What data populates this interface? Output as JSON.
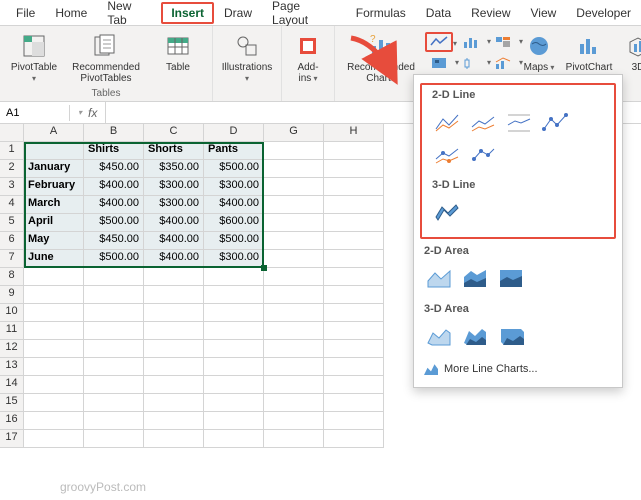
{
  "tabs": {
    "file": "File",
    "home": "Home",
    "newtab": "New Tab",
    "insert": "Insert",
    "draw": "Draw",
    "pagelayout": "Page Layout",
    "formulas": "Formulas",
    "data": "Data",
    "review": "Review",
    "view": "View",
    "developer": "Developer"
  },
  "ribbon": {
    "pivottable": "PivotTable",
    "recpivot": "Recommended\nPivotTables",
    "table": "Table",
    "tables_group": "Tables",
    "illustrations": "Illustrations",
    "addins": "Add-\nins",
    "reccharts": "Recommended\nCharts",
    "maps": "Maps",
    "pivotchart": "PivotChart",
    "threeD": "3D"
  },
  "fx": {
    "namebox": "A1",
    "symbol": "fx"
  },
  "cols": [
    "A",
    "B",
    "C",
    "D",
    "G",
    "H"
  ],
  "rows": [
    "1",
    "2",
    "3",
    "4",
    "5",
    "6",
    "7",
    "8",
    "9",
    "10",
    "11",
    "12",
    "13",
    "14",
    "15",
    "16",
    "17"
  ],
  "grid": {
    "hdr": [
      "",
      "Shirts",
      "Shorts",
      "Pants"
    ],
    "data": [
      [
        "January",
        "$450.00",
        "$350.00",
        "$500.00"
      ],
      [
        "February",
        "$400.00",
        "$300.00",
        "$300.00"
      ],
      [
        "March",
        "$400.00",
        "$300.00",
        "$400.00"
      ],
      [
        "April",
        "$500.00",
        "$400.00",
        "$600.00"
      ],
      [
        "May",
        "$450.00",
        "$400.00",
        "$500.00"
      ],
      [
        "June",
        "$500.00",
        "$400.00",
        "$300.00"
      ]
    ]
  },
  "menu": {
    "line2d": "2-D Line",
    "line3d": "3-D Line",
    "area2d": "2-D Area",
    "area3d": "3-D Area",
    "more": "More Line Charts..."
  },
  "chart_data": {
    "type": "line",
    "categories": [
      "January",
      "February",
      "March",
      "April",
      "May",
      "June"
    ],
    "series": [
      {
        "name": "Shirts",
        "values": [
          450,
          400,
          400,
          500,
          450,
          500
        ]
      },
      {
        "name": "Shorts",
        "values": [
          350,
          300,
          300,
          400,
          400,
          400
        ]
      },
      {
        "name": "Pants",
        "values": [
          500,
          300,
          400,
          600,
          500,
          300
        ]
      }
    ],
    "title": "",
    "xlabel": "",
    "ylabel": "",
    "ylim": [
      0,
      700
    ]
  },
  "watermark": "groovyPost.com"
}
